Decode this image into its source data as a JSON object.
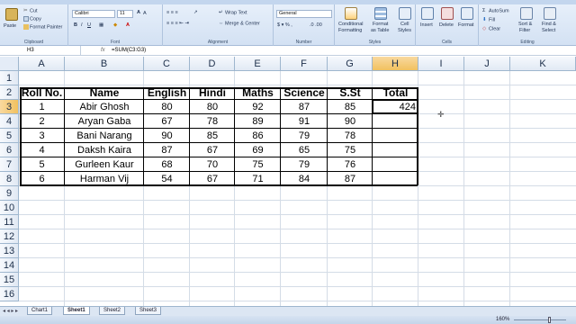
{
  "ribbon": {
    "clipboard": {
      "label": "Clipboard",
      "paste": "Paste",
      "cut": "Cut",
      "copy": "Copy",
      "format_painter": "Format Painter"
    },
    "font": {
      "label": "Font",
      "font_name": "Calibri",
      "font_size": "11"
    },
    "alignment": {
      "label": "Alignment",
      "wrap_text": "Wrap Text",
      "merge_center": "Merge & Center"
    },
    "number": {
      "label": "Number",
      "format": "General"
    },
    "styles": {
      "label": "Styles",
      "conditional": "Conditional",
      "conditional2": "Formatting",
      "format_table": "Format",
      "format_table2": "as Table",
      "cell_styles": "Cell",
      "cell_styles2": "Styles"
    },
    "cells": {
      "label": "Cells",
      "insert": "Insert",
      "delete": "Delete",
      "format": "Format"
    },
    "editing": {
      "label": "Editing",
      "autosum": "AutoSum",
      "fill": "Fill",
      "clear": "Clear",
      "sort_filter": "Sort &",
      "sort_filter2": "Filter",
      "find_select": "Find &",
      "find_select2": "Select"
    }
  },
  "formula_bar": {
    "name_box": "H3",
    "fx": "fx",
    "formula": "=SUM(C3:G3)"
  },
  "columns": [
    "A",
    "B",
    "C",
    "D",
    "E",
    "F",
    "G",
    "H",
    "I",
    "J",
    "K"
  ],
  "rows": [
    "1",
    "2",
    "3",
    "4",
    "5",
    "6",
    "7",
    "8",
    "9",
    "10",
    "11",
    "12",
    "13",
    "14",
    "15",
    "16"
  ],
  "table": {
    "headers": [
      "Roll No.",
      "Name",
      "English",
      "Hindi",
      "Maths",
      "Science",
      "S.St",
      "Total"
    ],
    "rows": [
      [
        "1",
        "Abir Ghosh",
        "80",
        "80",
        "92",
        "87",
        "85",
        "424"
      ],
      [
        "2",
        "Aryan Gaba",
        "67",
        "78",
        "89",
        "91",
        "90",
        ""
      ],
      [
        "3",
        "Bani Narang",
        "90",
        "85",
        "86",
        "79",
        "78",
        ""
      ],
      [
        "4",
        "Daksh Kaira",
        "87",
        "67",
        "69",
        "65",
        "75",
        ""
      ],
      [
        "5",
        "Gurleen Kaur",
        "68",
        "70",
        "75",
        "79",
        "76",
        ""
      ],
      [
        "6",
        "Harman Vij",
        "54",
        "67",
        "71",
        "84",
        "87",
        ""
      ]
    ]
  },
  "sheets": [
    "Chart1",
    "Sheet1",
    "Sheet2",
    "Sheet3"
  ],
  "active_sheet": "Sheet1",
  "status": {
    "zoom": "160%"
  }
}
